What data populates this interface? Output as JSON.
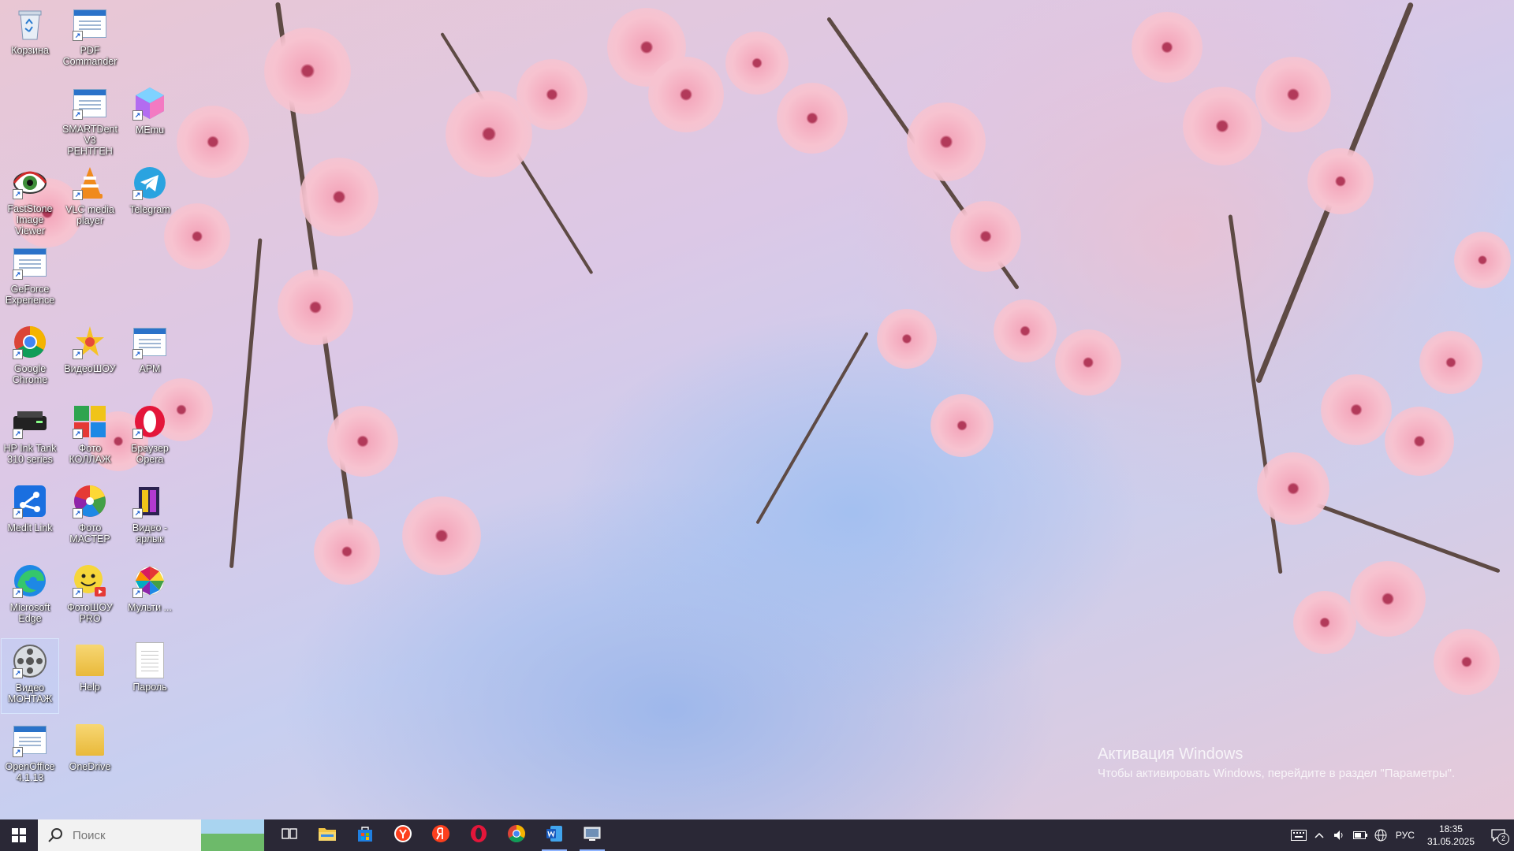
{
  "desktop": {
    "icons": [
      {
        "id": "recycle",
        "label": "Корзина",
        "icon": "recycle-bin-icon"
      },
      {
        "id": "pdf",
        "label": "PDF Commander",
        "icon": "pdf-commander-icon"
      },
      {
        "id": "smartdent",
        "label": "SMARTDent V3 РЕНТГЕН",
        "icon": "smartdent-icon"
      },
      {
        "id": "memu",
        "label": "MEmu",
        "icon": "memu-icon"
      },
      {
        "id": "faststone",
        "label": "FastStone Image Viewer",
        "icon": "faststone-icon"
      },
      {
        "id": "vlc",
        "label": "VLC media player",
        "icon": "vlc-icon"
      },
      {
        "id": "telegram",
        "label": "Telegram",
        "icon": "telegram-icon"
      },
      {
        "id": "geforce",
        "label": "GeForce Experience",
        "icon": "geforce-icon"
      },
      {
        "id": "chrome",
        "label": "Google Chrome",
        "icon": "chrome-icon"
      },
      {
        "id": "videoshow",
        "label": "ВидеоШОУ",
        "icon": "videoshow-icon"
      },
      {
        "id": "arm",
        "label": "АРМ",
        "icon": "arm-icon"
      },
      {
        "id": "hp",
        "label": "HP Ink Tank 310 series",
        "icon": "printer-icon"
      },
      {
        "id": "fotokollazh",
        "label": "Фото КОЛЛАЖ",
        "icon": "photo-collage-icon"
      },
      {
        "id": "opera",
        "label": "Браузер Opera",
        "icon": "opera-icon"
      },
      {
        "id": "medit",
        "label": "Medit Link",
        "icon": "medit-link-icon"
      },
      {
        "id": "fotomaster",
        "label": "Фото МАСТЕР",
        "icon": "photo-master-icon"
      },
      {
        "id": "videoyarlyk",
        "label": "Видео - ярлык",
        "icon": "video-shortcut-icon"
      },
      {
        "id": "edge",
        "label": "Microsoft Edge",
        "icon": "edge-icon"
      },
      {
        "id": "fotoshow",
        "label": "ФотоШОУ PRO",
        "icon": "photoshow-icon"
      },
      {
        "id": "multi",
        "label": "Мульти ...",
        "icon": "multi-icon"
      },
      {
        "id": "videomontazh",
        "label": "Видео МОНТАЖ",
        "icon": "video-montage-icon",
        "selected": true
      },
      {
        "id": "help",
        "label": "Help",
        "icon": "folder-icon"
      },
      {
        "id": "parol",
        "label": "Пароль",
        "icon": "text-document-icon"
      },
      {
        "id": "openoffice",
        "label": "OpenOffice 4.1.13",
        "icon": "openoffice-icon"
      },
      {
        "id": "onedrive",
        "label": "OneDrive",
        "icon": "folder-icon"
      }
    ],
    "watermark": {
      "title": "Активация Windows",
      "subtitle": "Чтобы активировать Windows, перейдите в раздел \"Параметры\"."
    }
  },
  "taskbar": {
    "search_placeholder": "Поиск",
    "apps": [
      {
        "id": "taskview",
        "icon": "task-view-icon"
      },
      {
        "id": "explorer",
        "icon": "file-explorer-icon"
      },
      {
        "id": "store",
        "icon": "store-icon"
      },
      {
        "id": "yandex-browser",
        "icon": "yandex-browser-icon"
      },
      {
        "id": "yandex",
        "icon": "yandex-icon"
      },
      {
        "id": "opera",
        "icon": "opera-icon"
      },
      {
        "id": "chrome",
        "icon": "chrome-icon"
      },
      {
        "id": "word",
        "icon": "word-icon",
        "active": true
      },
      {
        "id": "screen",
        "icon": "screen-app-icon",
        "active": true
      }
    ],
    "tray": {
      "language": "РУС",
      "time": "18:35",
      "date": "31.05.2025",
      "notification_count": "2"
    }
  },
  "colors": {
    "taskbar": "#2a2836",
    "accent": "#2a72c9"
  }
}
